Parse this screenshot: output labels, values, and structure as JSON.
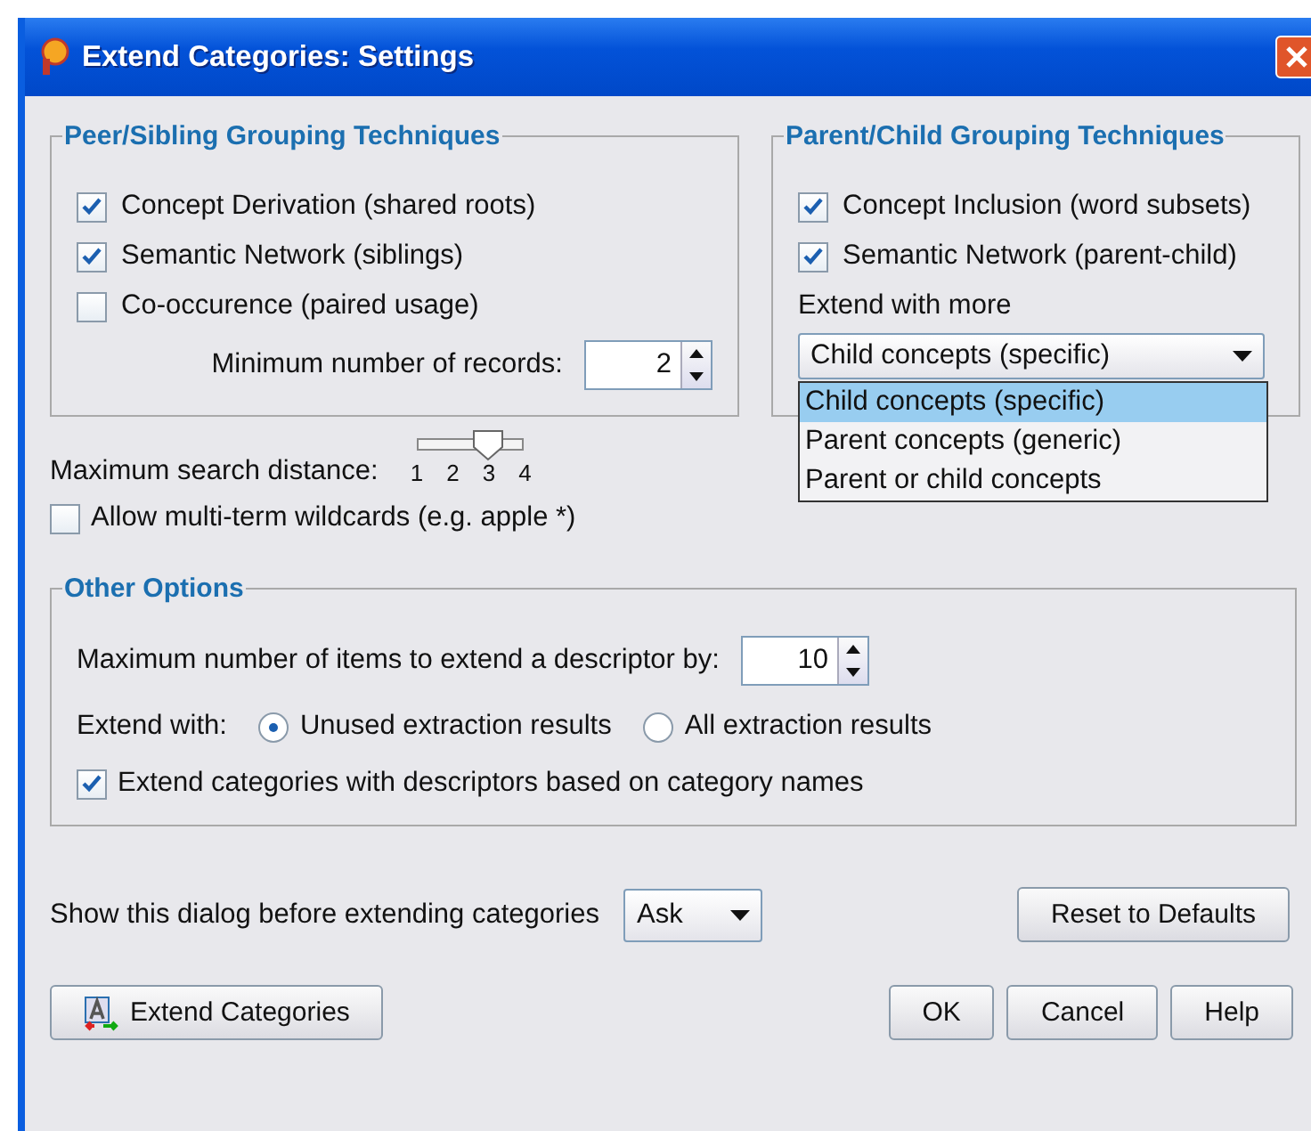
{
  "window": {
    "title": "Extend Categories: Settings"
  },
  "peer_group": {
    "title": "Peer/Sibling Grouping Techniques",
    "options": [
      {
        "label": "Concept Derivation (shared roots)",
        "checked": true
      },
      {
        "label": "Semantic Network (siblings)",
        "checked": true
      },
      {
        "label": "Co-occurence (paired usage)",
        "checked": false
      }
    ],
    "min_records": {
      "label": "Minimum number of records:",
      "value": "2"
    }
  },
  "parent_group": {
    "title": "Parent/Child Grouping Techniques",
    "options": [
      {
        "label": "Concept Inclusion (word subsets)",
        "checked": true
      },
      {
        "label": "Semantic Network (parent-child)",
        "checked": true
      }
    ],
    "extend_label": "Extend with more",
    "dropdown": {
      "value": "Child concepts (specific)",
      "expanded": true,
      "options": [
        {
          "label": "Child concepts (specific)",
          "selected": true
        },
        {
          "label": "Parent concepts (generic)",
          "selected": false
        },
        {
          "label": "Parent or child concepts",
          "selected": false
        }
      ]
    }
  },
  "search_distance": {
    "label": "Maximum search distance:",
    "level": 0.667,
    "ticks": [
      "1",
      "2",
      "3",
      "4"
    ]
  },
  "wildcards": {
    "label": "Allow multi-term wildcards (e.g. apple *)",
    "checked": false
  },
  "other": {
    "title": "Other Options",
    "max_items": {
      "label": "Maximum number of items to extend a descriptor by:",
      "value": "10"
    },
    "extend_with": {
      "label": "Extend with:",
      "choices": [
        {
          "label": "Unused extraction results",
          "selected": true
        },
        {
          "label": "All extraction results",
          "selected": false
        }
      ]
    },
    "name_descriptors": {
      "label": "Extend categories with descriptors based on category names",
      "checked": true
    }
  },
  "show_dialog": {
    "label": "Show this dialog before extending categories",
    "value": "Ask"
  },
  "reset_button": "Reset to Defaults",
  "extend_button": "Extend Categories",
  "buttons": [
    "OK",
    "Cancel",
    "Help"
  ]
}
